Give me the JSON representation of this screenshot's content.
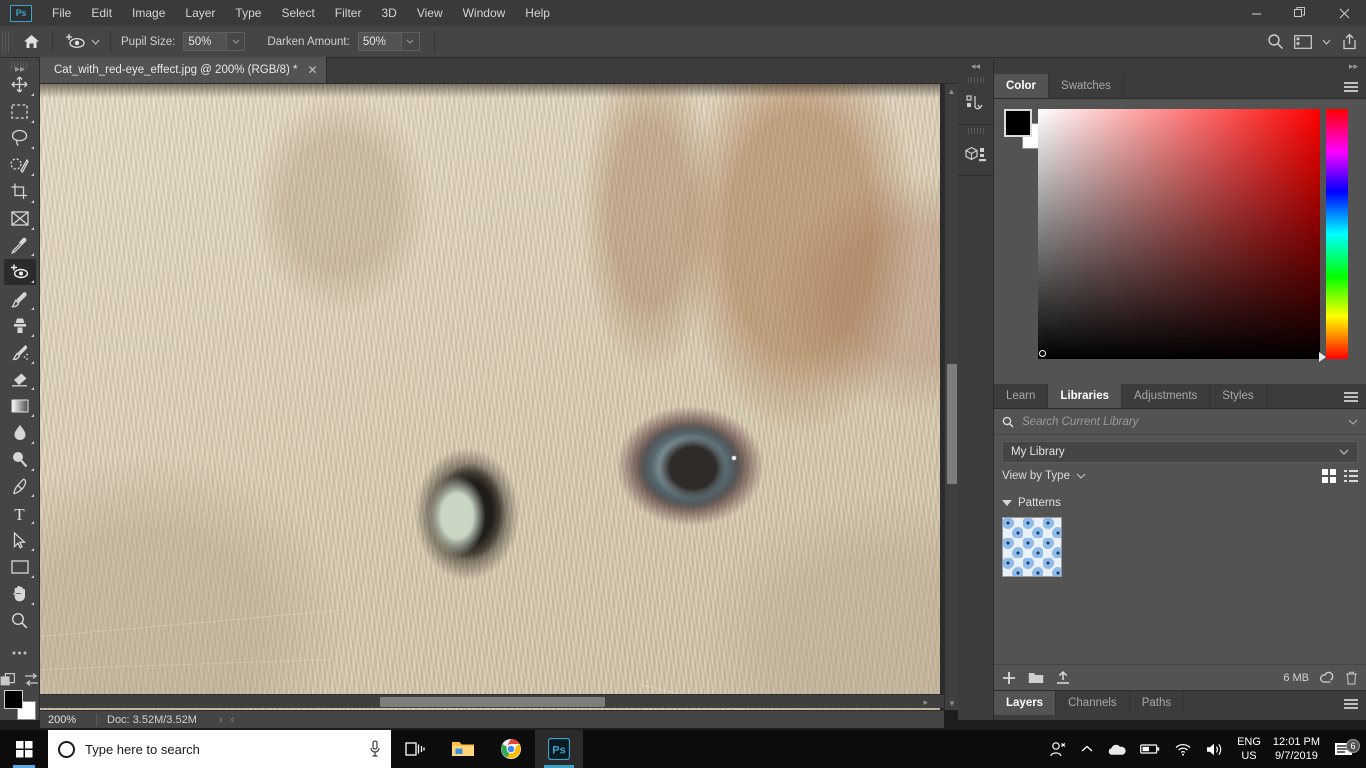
{
  "app": {
    "logo": "Ps",
    "name": "Adobe Photoshop"
  },
  "menubar": {
    "items": [
      "File",
      "Edit",
      "Image",
      "Layer",
      "Type",
      "Select",
      "Filter",
      "3D",
      "View",
      "Window",
      "Help"
    ]
  },
  "window_controls": {
    "minimize": "–",
    "restore": "❐",
    "close": "✕"
  },
  "options_bar": {
    "home_icon": "home-icon",
    "tool_preset_icon": "red-eye-tool-icon",
    "fields": [
      {
        "label": "Pupil Size:",
        "value": "50%"
      },
      {
        "label": "Darken Amount:",
        "value": "50%"
      }
    ],
    "right_icons": [
      "search-icon",
      "workspace-icon",
      "chevron-down-icon",
      "share-icon"
    ]
  },
  "toolbar": {
    "tools": [
      {
        "name": "move-tool",
        "active": false
      },
      {
        "name": "rectangular-marquee-tool",
        "active": false
      },
      {
        "name": "lasso-tool",
        "active": false
      },
      {
        "name": "object-selection-tool",
        "active": false
      },
      {
        "name": "crop-tool",
        "active": false
      },
      {
        "name": "frame-tool",
        "active": false
      },
      {
        "name": "eyedropper-tool",
        "active": false
      },
      {
        "name": "red-eye-tool",
        "active": true
      },
      {
        "name": "brush-tool",
        "active": false
      },
      {
        "name": "clone-stamp-tool",
        "active": false
      },
      {
        "name": "history-brush-tool",
        "active": false
      },
      {
        "name": "eraser-tool",
        "active": false
      },
      {
        "name": "gradient-tool",
        "active": false
      },
      {
        "name": "blur-tool",
        "active": false
      },
      {
        "name": "dodge-tool",
        "active": false
      },
      {
        "name": "pen-tool",
        "active": false
      },
      {
        "name": "type-tool",
        "active": false
      },
      {
        "name": "path-selection-tool",
        "active": false
      },
      {
        "name": "rectangle-tool",
        "active": false
      },
      {
        "name": "hand-tool",
        "active": false
      },
      {
        "name": "zoom-tool",
        "active": false
      },
      {
        "name": "edit-toolbar-tool",
        "active": false
      }
    ],
    "quickmask_icon": "quick-mask-icon",
    "screenmode_icon": "screen-mode-icon",
    "foreground_color": "#000000",
    "background_color": "#ffffff"
  },
  "document": {
    "tab_title": "Cat_with_red-eye_effect.jpg @ 200% (RGB/8) *",
    "close_label": "✕",
    "image_alt": "close-up photograph of a cream coloured cat's face showing both eyes"
  },
  "status_bar": {
    "zoom": "200%",
    "doc_size": "Doc: 3.52M/3.52M",
    "right_chevron": "›",
    "left_chevron": "‹"
  },
  "dock_rail": {
    "collapse_icon": "double-chevron-left-icon",
    "expand_icon": "double-chevron-right-icon",
    "buttons": [
      "history-panel-icon",
      "3d-panel-icon"
    ]
  },
  "color_panel": {
    "tabs": [
      {
        "label": "Color",
        "active": true
      },
      {
        "label": "Swatches",
        "active": false
      }
    ],
    "menu_icon": "panel-menu-icon",
    "foreground_color": "#000000",
    "background_color": "#ffffff",
    "spectrum_from": "#ffffff",
    "spectrum_to": "#ff0000"
  },
  "libraries_panel": {
    "tabs": [
      {
        "label": "Learn",
        "active": false
      },
      {
        "label": "Libraries",
        "active": true
      },
      {
        "label": "Adjustments",
        "active": false
      },
      {
        "label": "Styles",
        "active": false
      }
    ],
    "menu_icon": "panel-menu-icon",
    "search_placeholder": "Search Current Library",
    "search_value": "",
    "library_select": "My Library",
    "view_by": "View by Type",
    "view_grid_icon": "grid-view-icon",
    "view_list_icon": "list-view-icon",
    "groups": [
      {
        "label": "Patterns",
        "expanded": true,
        "items": [
          {
            "name": "blue-dots-pattern"
          }
        ]
      }
    ],
    "footer": {
      "add_icon": "add-content-icon",
      "folder_icon": "new-group-icon",
      "upload_icon": "upload-icon",
      "size": "6 MB",
      "sync_icon": "creative-cloud-icon",
      "delete_icon": "trash-icon"
    }
  },
  "layers_panel": {
    "tabs": [
      {
        "label": "Layers",
        "active": true
      },
      {
        "label": "Channels",
        "active": false
      },
      {
        "label": "Paths",
        "active": false
      }
    ],
    "menu_icon": "panel-menu-icon"
  },
  "taskbar": {
    "start_icon": "windows-start-icon",
    "search_placeholder": "Type here to search",
    "mic_icon": "microphone-icon",
    "taskview_icon": "task-view-icon",
    "apps": [
      {
        "name": "file-explorer-icon",
        "open": true
      },
      {
        "name": "google-chrome-icon",
        "open": true
      },
      {
        "name": "photoshop-icon",
        "open": true,
        "active": true
      }
    ],
    "tray": {
      "people_icon": "people-icon",
      "overflow_icon": "show-hidden-icons-chevron",
      "onedrive_icon": "onedrive-icon",
      "battery_icon": "battery-icon",
      "network_icon": "wifi-icon",
      "volume_icon": "volume-icon",
      "language_line1": "ENG",
      "language_line2": "US",
      "time": "12:01 PM",
      "date": "9/7/2019",
      "notifications_icon": "action-center-icon",
      "notifications_count": "6"
    }
  }
}
